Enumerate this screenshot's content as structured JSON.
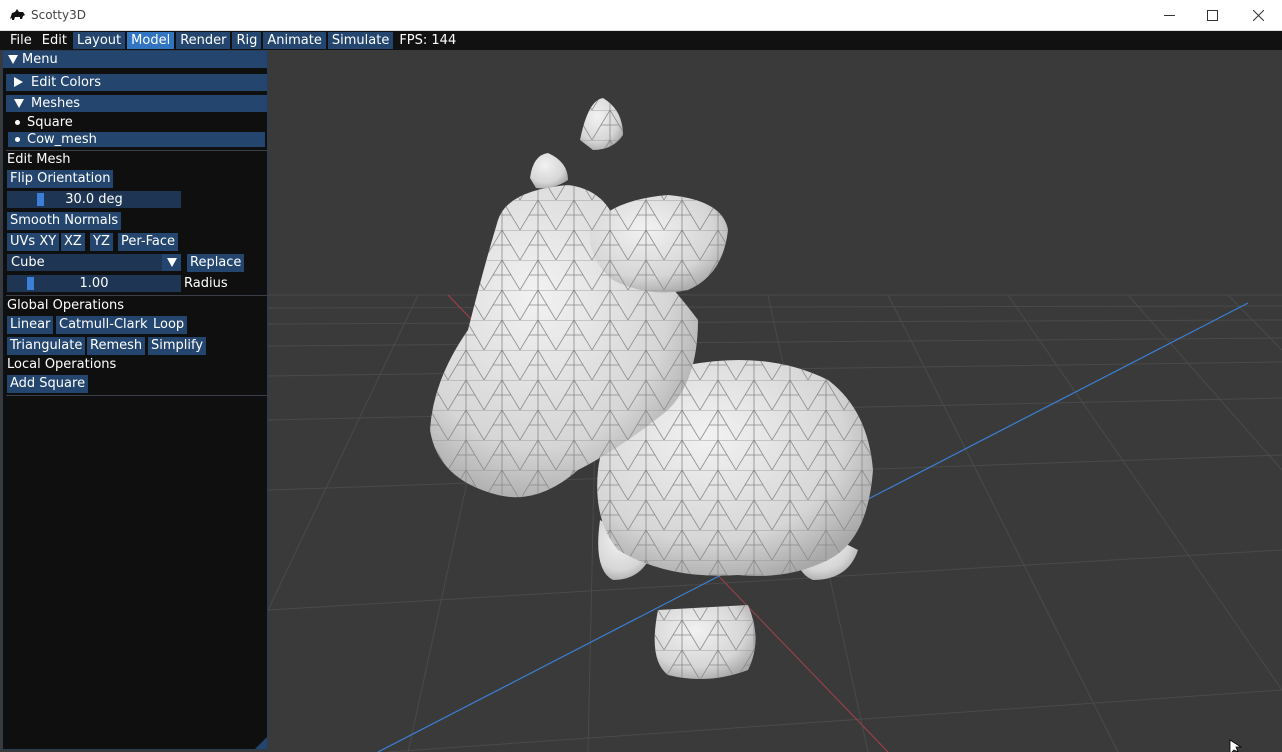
{
  "window": {
    "title": "Scotty3D",
    "minimize_icon": "minimize-icon",
    "maximize_icon": "maximize-icon",
    "close_icon": "close-icon"
  },
  "menubar": {
    "file": "File",
    "edit": "Edit",
    "layout": "Layout",
    "model": "Model",
    "render": "Render",
    "rig": "Rig",
    "animate": "Animate",
    "simulate": "Simulate",
    "fps": "FPS: 144"
  },
  "panel": {
    "title": "Menu",
    "edit_colors": "Edit Colors",
    "meshes": "Meshes",
    "mesh_items": [
      "Square",
      "Cow_mesh"
    ],
    "selected_mesh": "Cow_mesh",
    "edit_mesh_heading": "Edit Mesh",
    "flip_orientation": "Flip Orientation",
    "angle_slider": "30.0 deg",
    "smooth_normals": "Smooth Normals",
    "uv_buttons": [
      "UVs XY",
      "XZ",
      "YZ",
      "Per-Face"
    ],
    "shape_select": "Cube",
    "replace": "Replace",
    "radius_value": "1.00",
    "radius_label": "Radius",
    "global_ops_heading": "Global Operations",
    "global_ops_row1": [
      "Linear",
      "Catmull-Clark",
      "Loop"
    ],
    "global_ops_row2": [
      "Triangulate",
      "Remesh",
      "Simplify"
    ],
    "local_ops_heading": "Local Operations",
    "add_square": "Add Square"
  },
  "colors": {
    "menubar_bg": "#111111",
    "button_bg": "#24466e",
    "active_tab": "#3174c2",
    "viewport_bg": "#3a3a3a",
    "axis_blue": "#3b7fd4",
    "axis_red": "#b0414b",
    "mesh_fill": "#d9d9d9"
  }
}
